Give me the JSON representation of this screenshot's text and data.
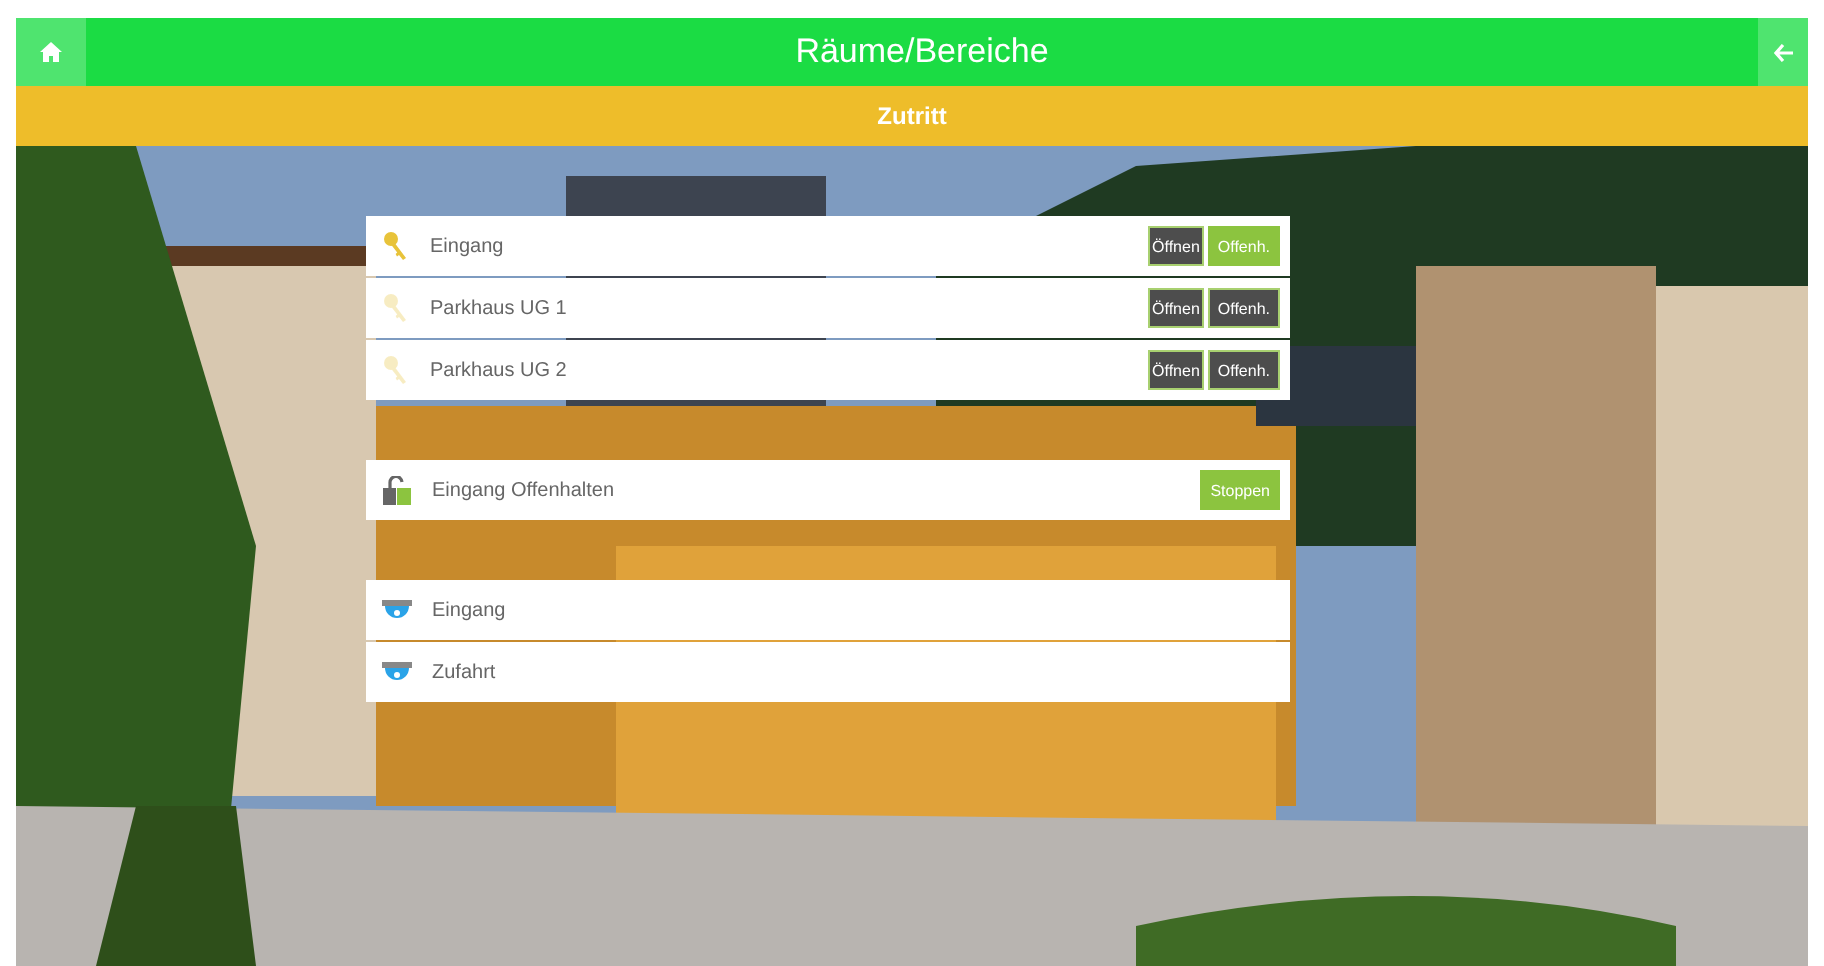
{
  "header": {
    "title": "Räume/Bereiche"
  },
  "subheader": {
    "title": "Zutritt"
  },
  "groups": [
    {
      "rows": [
        {
          "kind": "door",
          "label": "Eingang",
          "active": true,
          "buttons": [
            {
              "label": "Öffnen",
              "on": false
            },
            {
              "label": "Offenh.",
              "on": true
            }
          ]
        },
        {
          "kind": "door",
          "label": "Parkhaus UG 1",
          "active": false,
          "buttons": [
            {
              "label": "Öffnen",
              "on": false
            },
            {
              "label": "Offenh.",
              "on": false
            }
          ]
        },
        {
          "kind": "door",
          "label": "Parkhaus UG 2",
          "active": false,
          "buttons": [
            {
              "label": "Öffnen",
              "on": false
            },
            {
              "label": "Offenh.",
              "on": false
            }
          ]
        }
      ]
    },
    {
      "rows": [
        {
          "kind": "hold",
          "label": "Eingang Offenhalten",
          "buttons": [
            {
              "label": "Stoppen",
              "on": true
            }
          ]
        }
      ]
    },
    {
      "rows": [
        {
          "kind": "camera",
          "label": "Eingang"
        },
        {
          "kind": "camera",
          "label": "Zufahrt"
        }
      ]
    }
  ]
}
